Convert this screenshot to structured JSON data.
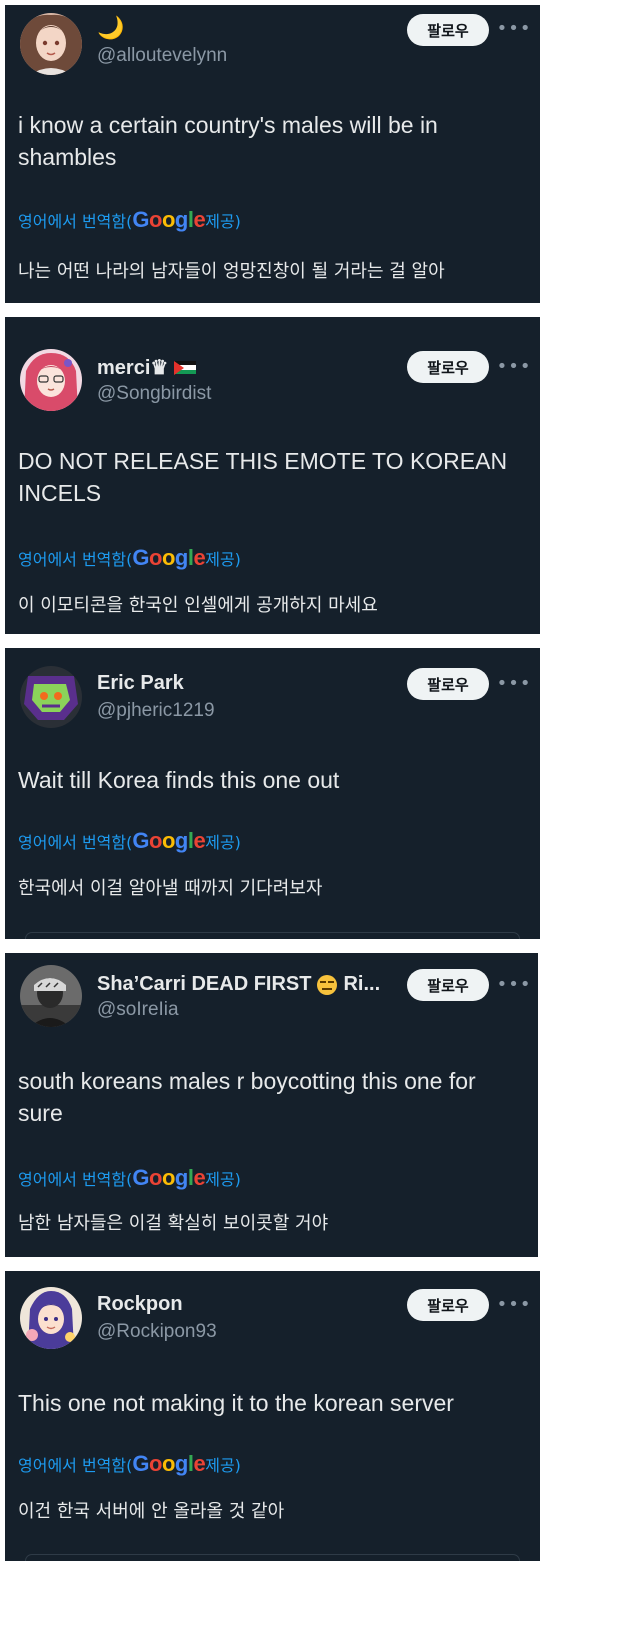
{
  "follow_label": "팔로우",
  "more_icon": "more-horizontal-icon",
  "translate": {
    "prefix": "영어에서 번역함(",
    "google_letters": [
      "G",
      "o",
      "o",
      "g",
      "l",
      "e"
    ],
    "suffix": " 제공)"
  },
  "posts": [
    {
      "display_name": "🌙",
      "handle": "@alloutevelynn",
      "text": "i know a certain country's males will be in shambles",
      "translated": "나는 어떤 나라의 남자들이 엉망진창이 될 거라는 걸 알아"
    },
    {
      "display_name": "merci♛",
      "handle": "@Songbirdist",
      "text": "DO NOT RELEASE THIS EMOTE TO KOREAN INCELS",
      "translated": "이 이모티콘을 한국인 인셀에게 공개하지 마세요"
    },
    {
      "display_name": "Eric Park",
      "handle": "@pjheric1219",
      "text": "Wait till Korea finds this one out",
      "translated": "한국에서 이걸 알아낼 때까지 기다려보자"
    },
    {
      "display_name": "Sha’Carri DEAD FIRST",
      "display_name_tail": "Ri...",
      "handle": "@soIreIia",
      "text": "south koreans males r boycotting this one for sure",
      "translated": "남한 남자들은 이걸 확실히 보이콧할 거야"
    },
    {
      "display_name": "Rockpon",
      "handle": "@Rockipon93",
      "text": "This one not making it to the korean server",
      "translated": "이건 한국 서버에 안 올라올 것 같아"
    }
  ]
}
